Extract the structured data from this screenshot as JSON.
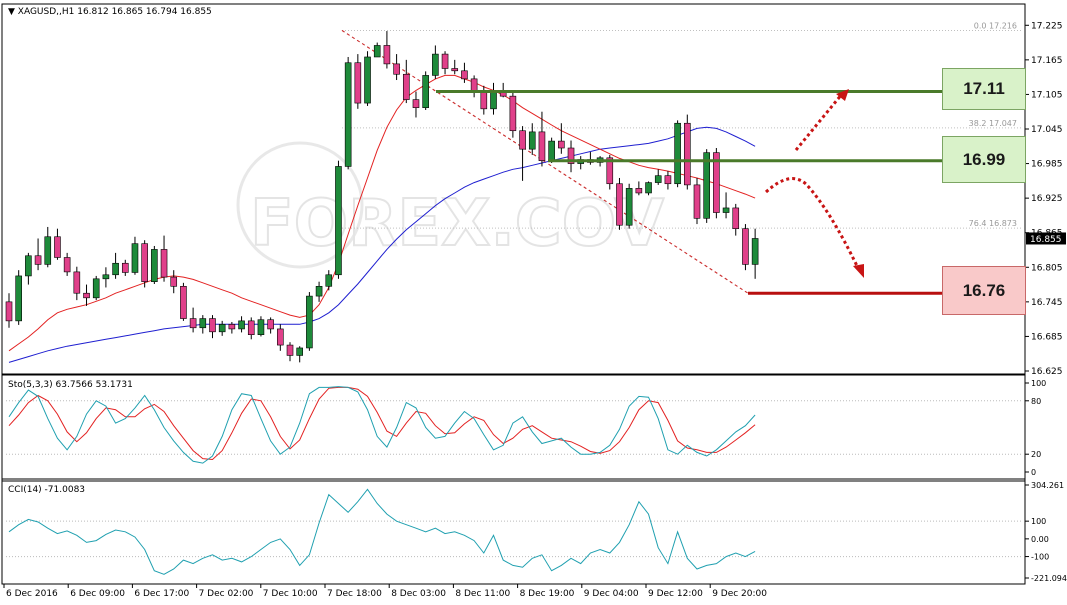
{
  "chart_data": {
    "type": "candlestick",
    "symbol_header": "XAGUSD,,H1  16.812 16.865 16.794 16.855",
    "price_axis": {
      "ylim": [
        16.625,
        17.255
      ],
      "ticks": [
        "17.225",
        "17.165",
        "17.105",
        "17.045",
        "16.985",
        "16.925",
        "16.865",
        "16.805",
        "16.745",
        "16.685",
        "16.625"
      ],
      "current_price_label": "16.855"
    },
    "time_labels": [
      "6 Dec 2016",
      "6 Dec 09:00",
      "6 Dec 17:00",
      "7 Dec 02:00",
      "7 Dec 10:00",
      "7 Dec 18:00",
      "8 Dec 03:00",
      "8 Dec 11:00",
      "8 Dec 19:00",
      "9 Dec 04:00",
      "9 Dec 12:00",
      "9 Dec 20:00"
    ],
    "fib_labels": [
      {
        "text": "0.0  17.216",
        "value": 17.216
      },
      {
        "text": "38.2  17.047",
        "value": 17.047
      },
      {
        "text": "76.4  16.873",
        "value": 16.873
      }
    ],
    "key_levels": [
      {
        "label": "17.11",
        "value": 17.11,
        "kind": "resistance"
      },
      {
        "label": "16.99",
        "value": 16.99,
        "kind": "support"
      },
      {
        "label": "16.76",
        "value": 16.76,
        "kind": "target"
      }
    ],
    "watermark": "FOREX.COV",
    "stochastic": {
      "header": "Sto(5,3,3) 63.7566 53.1731",
      "ticks": [
        "100",
        "80",
        "20",
        "0"
      ],
      "main": [
        62,
        78,
        92,
        85,
        60,
        38,
        25,
        40,
        65,
        80,
        74,
        55,
        60,
        72,
        86,
        70,
        50,
        35,
        22,
        12,
        10,
        18,
        40,
        70,
        88,
        86,
        60,
        35,
        20,
        28,
        55,
        88,
        95,
        95,
        96,
        95,
        90,
        70,
        40,
        28,
        50,
        78,
        72,
        50,
        38,
        40,
        55,
        68,
        60,
        42,
        25,
        30,
        55,
        62,
        45,
        32,
        35,
        38,
        28,
        20,
        20,
        22,
        30,
        48,
        74,
        85,
        84,
        60,
        25,
        20,
        30,
        22,
        18,
        25,
        35,
        45,
        52,
        64
      ],
      "signal": [
        52,
        64,
        78,
        86,
        80,
        65,
        45,
        34,
        44,
        60,
        72,
        70,
        62,
        62,
        71,
        76,
        68,
        52,
        38,
        24,
        15,
        14,
        24,
        44,
        66,
        82,
        80,
        62,
        40,
        26,
        36,
        60,
        82,
        94,
        95,
        95,
        93,
        85,
        67,
        46,
        40,
        55,
        68,
        66,
        52,
        43,
        44,
        54,
        62,
        58,
        42,
        32,
        38,
        48,
        52,
        45,
        38,
        36,
        34,
        29,
        23,
        21,
        24,
        34,
        50,
        70,
        80,
        78,
        58,
        35,
        27,
        25,
        22,
        22,
        28,
        36,
        44,
        53
      ]
    },
    "cci": {
      "header": "CCI(14) -71.0083",
      "ticks": [
        "304.261",
        "100",
        "0.00",
        "-100",
        "-221.094"
      ],
      "ylim": [
        -221.094,
        304.261
      ],
      "values": [
        40,
        80,
        110,
        95,
        60,
        30,
        45,
        20,
        -20,
        -10,
        25,
        50,
        40,
        10,
        -60,
        -180,
        -200,
        -170,
        -120,
        -140,
        -110,
        -90,
        -120,
        -110,
        -130,
        -100,
        -60,
        -20,
        0,
        -60,
        -150,
        -90,
        90,
        250,
        200,
        150,
        210,
        280,
        200,
        140,
        100,
        80,
        60,
        40,
        60,
        30,
        40,
        20,
        -10,
        -80,
        20,
        -120,
        -150,
        -160,
        -110,
        -90,
        -180,
        -150,
        -110,
        -140,
        -80,
        -60,
        -80,
        -20,
        80,
        210,
        140,
        -50,
        -140,
        40,
        -110,
        -170,
        -150,
        -140,
        -100,
        -80,
        -100,
        -71
      ]
    },
    "candles": [
      [
        16.745,
        16.76,
        16.7,
        16.712
      ],
      [
        16.712,
        16.8,
        16.705,
        16.79
      ],
      [
        16.79,
        16.83,
        16.775,
        16.825
      ],
      [
        16.825,
        16.855,
        16.8,
        16.81
      ],
      [
        16.81,
        16.875,
        16.805,
        16.858
      ],
      [
        16.858,
        16.872,
        16.818,
        16.822
      ],
      [
        16.822,
        16.83,
        16.79,
        16.797
      ],
      [
        16.797,
        16.806,
        16.748,
        16.76
      ],
      [
        16.76,
        16.775,
        16.738,
        16.752
      ],
      [
        16.752,
        16.79,
        16.748,
        16.785
      ],
      [
        16.785,
        16.805,
        16.77,
        16.792
      ],
      [
        16.792,
        16.83,
        16.785,
        16.812
      ],
      [
        16.812,
        16.818,
        16.79,
        16.796
      ],
      [
        16.796,
        16.858,
        16.792,
        16.846
      ],
      [
        16.846,
        16.852,
        16.77,
        16.78
      ],
      [
        16.78,
        16.842,
        16.776,
        16.836
      ],
      [
        16.836,
        16.86,
        16.78,
        16.788
      ],
      [
        16.788,
        16.8,
        16.76,
        16.772
      ],
      [
        16.772,
        16.778,
        16.712,
        16.716
      ],
      [
        16.716,
        16.735,
        16.692,
        16.7
      ],
      [
        16.7,
        16.722,
        16.69,
        16.716
      ],
      [
        16.716,
        16.722,
        16.682,
        16.693
      ],
      [
        16.693,
        16.712,
        16.686,
        16.706
      ],
      [
        16.706,
        16.71,
        16.69,
        16.698
      ],
      [
        16.698,
        16.72,
        16.692,
        16.712
      ],
      [
        16.712,
        16.718,
        16.68,
        16.688
      ],
      [
        16.688,
        16.72,
        16.685,
        16.714
      ],
      [
        16.714,
        16.718,
        16.69,
        16.698
      ],
      [
        16.698,
        16.706,
        16.66,
        16.67
      ],
      [
        16.67,
        16.675,
        16.642,
        16.652
      ],
      [
        16.652,
        16.668,
        16.64,
        16.665
      ],
      [
        16.665,
        16.762,
        16.66,
        16.755
      ],
      [
        16.755,
        16.78,
        16.745,
        16.772
      ],
      [
        16.772,
        16.8,
        16.765,
        16.792
      ],
      [
        16.792,
        16.99,
        16.785,
        16.98
      ],
      [
        16.98,
        17.17,
        16.975,
        17.16
      ],
      [
        17.16,
        17.175,
        17.08,
        17.09
      ],
      [
        17.09,
        17.18,
        17.085,
        17.17
      ],
      [
        17.17,
        17.195,
        17.17,
        17.19
      ],
      [
        17.19,
        17.215,
        17.15,
        17.158
      ],
      [
        17.158,
        17.175,
        17.13,
        17.14
      ],
      [
        17.14,
        17.165,
        17.09,
        17.096
      ],
      [
        17.096,
        17.11,
        17.065,
        17.082
      ],
      [
        17.082,
        17.145,
        17.078,
        17.138
      ],
      [
        17.138,
        17.19,
        17.132,
        17.175
      ],
      [
        17.175,
        17.18,
        17.14,
        17.15
      ],
      [
        17.15,
        17.165,
        17.14,
        17.146
      ],
      [
        17.146,
        17.16,
        17.125,
        17.132
      ],
      [
        17.132,
        17.138,
        17.1,
        17.108
      ],
      [
        17.108,
        17.12,
        17.07,
        17.08
      ],
      [
        17.08,
        17.125,
        17.07,
        17.11
      ],
      [
        17.11,
        17.125,
        17.1,
        17.102
      ],
      [
        17.102,
        17.108,
        17.03,
        17.042
      ],
      [
        17.042,
        17.05,
        16.955,
        17.01
      ],
      [
        17.01,
        17.055,
        17.0,
        17.04
      ],
      [
        17.04,
        17.075,
        16.98,
        16.99
      ],
      [
        16.99,
        17.03,
        16.986,
        17.024
      ],
      [
        17.024,
        17.055,
        17.002,
        17.012
      ],
      [
        17.012,
        17.025,
        16.97,
        16.985
      ],
      [
        16.985,
        16.998,
        16.975,
        16.992
      ],
      [
        16.992,
        17.005,
        16.983,
        16.987
      ],
      [
        16.987,
        16.998,
        16.98,
        16.995
      ],
      [
        16.995,
        17.0,
        16.94,
        16.95
      ],
      [
        16.95,
        16.96,
        16.87,
        16.878
      ],
      [
        16.878,
        16.95,
        16.872,
        16.942
      ],
      [
        16.942,
        16.954,
        16.93,
        16.934
      ],
      [
        16.934,
        16.954,
        16.93,
        16.952
      ],
      [
        16.952,
        16.975,
        16.948,
        16.964
      ],
      [
        16.964,
        16.972,
        16.94,
        16.95
      ],
      [
        16.95,
        17.06,
        16.944,
        17.055
      ],
      [
        17.055,
        17.07,
        16.94,
        16.948
      ],
      [
        16.948,
        16.96,
        16.88,
        16.89
      ],
      [
        16.89,
        17.01,
        16.882,
        17.004
      ],
      [
        17.004,
        17.012,
        16.89,
        16.9
      ],
      [
        16.9,
        16.935,
        16.89,
        16.908
      ],
      [
        16.908,
        16.915,
        16.86,
        16.872
      ],
      [
        16.872,
        16.88,
        16.8,
        16.81
      ],
      [
        16.81,
        16.872,
        16.785,
        16.855
      ]
    ],
    "ma_fast": [
      16.66,
      16.672,
      16.684,
      16.698,
      16.714,
      16.726,
      16.732,
      16.736,
      16.74,
      16.746,
      16.752,
      16.76,
      16.766,
      16.772,
      16.778,
      16.784,
      16.788,
      16.79,
      16.788,
      16.784,
      16.778,
      16.772,
      16.766,
      16.76,
      16.752,
      16.746,
      16.74,
      16.734,
      16.728,
      16.722,
      16.718,
      16.722,
      16.74,
      16.77,
      16.812,
      16.862,
      16.912,
      16.96,
      17.008,
      17.048,
      17.078,
      17.1,
      17.112,
      17.122,
      17.132,
      17.138,
      17.138,
      17.132,
      17.126,
      17.118,
      17.112,
      17.104,
      17.094,
      17.082,
      17.072,
      17.062,
      17.052,
      17.042,
      17.034,
      17.026,
      17.018,
      17.01,
      17.002,
      16.994,
      16.988,
      16.982,
      16.978,
      16.975,
      16.972,
      16.968,
      16.964,
      16.96,
      16.955,
      16.95,
      16.944,
      16.938,
      16.932,
      16.925
    ],
    "ma_slow": [
      16.64,
      16.645,
      16.65,
      16.655,
      16.66,
      16.664,
      16.668,
      16.671,
      16.674,
      16.677,
      16.68,
      16.683,
      16.686,
      16.689,
      16.692,
      16.695,
      16.698,
      16.7,
      16.702,
      16.704,
      16.706,
      16.706,
      16.706,
      16.706,
      16.706,
      16.706,
      16.706,
      16.706,
      16.706,
      16.706,
      16.706,
      16.71,
      16.716,
      16.726,
      16.74,
      16.758,
      16.776,
      16.796,
      16.816,
      16.836,
      16.854,
      16.87,
      16.884,
      16.898,
      16.912,
      16.924,
      16.934,
      16.944,
      16.952,
      16.958,
      16.964,
      16.97,
      16.975,
      16.978,
      16.982,
      16.986,
      16.99,
      16.994,
      16.998,
      17.002,
      17.006,
      17.01,
      17.012,
      17.014,
      17.016,
      17.018,
      17.02,
      17.024,
      17.028,
      17.034,
      17.04,
      17.046,
      17.048,
      17.046,
      17.04,
      17.032,
      17.024,
      17.015
    ]
  }
}
